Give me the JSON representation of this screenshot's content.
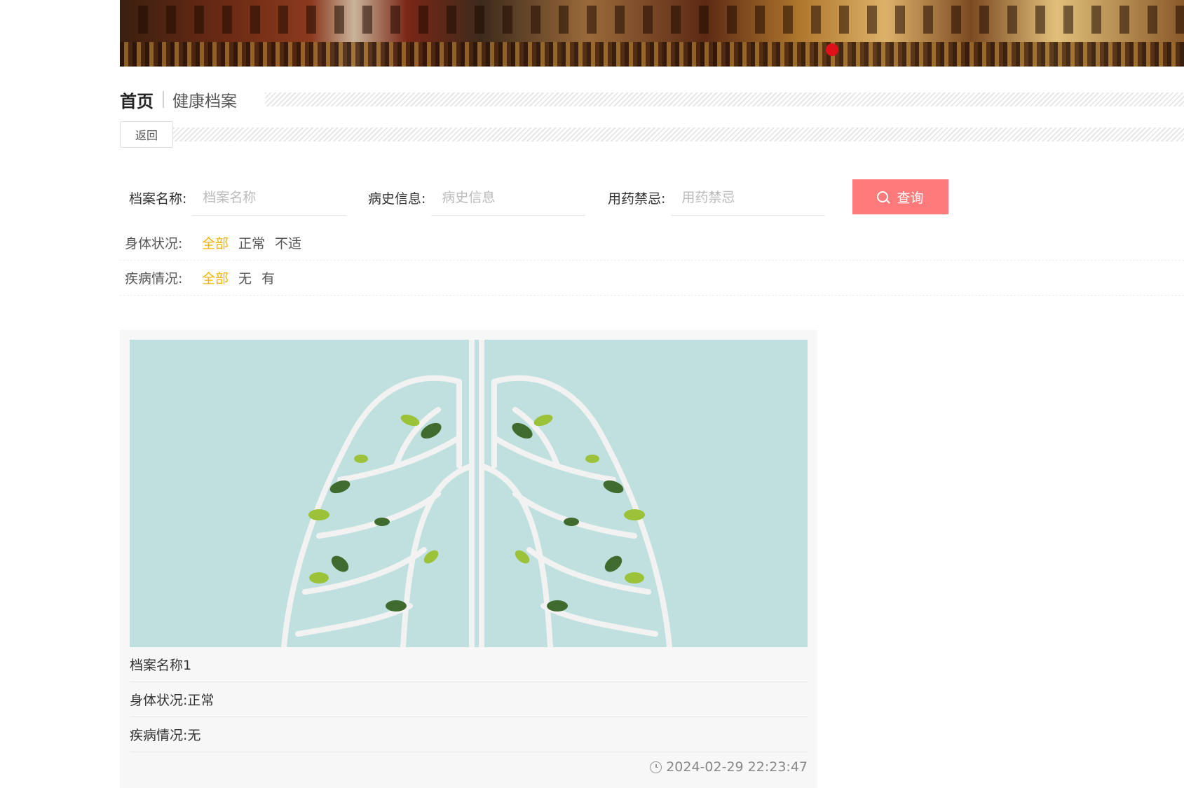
{
  "breadcrumb": {
    "home": "首页",
    "current": "健康档案"
  },
  "back_label": "返回",
  "search": {
    "fields": [
      {
        "label": "档案名称:",
        "placeholder": "档案名称"
      },
      {
        "label": "病史信息:",
        "placeholder": "病史信息"
      },
      {
        "label": "用药禁忌:",
        "placeholder": "用药禁忌"
      }
    ],
    "button": "查询"
  },
  "filters": [
    {
      "label": "身体状况:",
      "options": [
        "全部",
        "正常",
        "不适"
      ],
      "active": "全部"
    },
    {
      "label": "疾病情况:",
      "options": [
        "全部",
        "无",
        "有"
      ],
      "active": "全部"
    }
  ],
  "card": {
    "name": "档案名称1",
    "body_status": "身体状况:正常",
    "disease_status": "疾病情况:无",
    "time": "2024-02-29 22:23:47"
  },
  "colors": {
    "accent": "#ff7b7b",
    "active_option": "#f0b400",
    "carousel_dot": "#e0101a"
  }
}
